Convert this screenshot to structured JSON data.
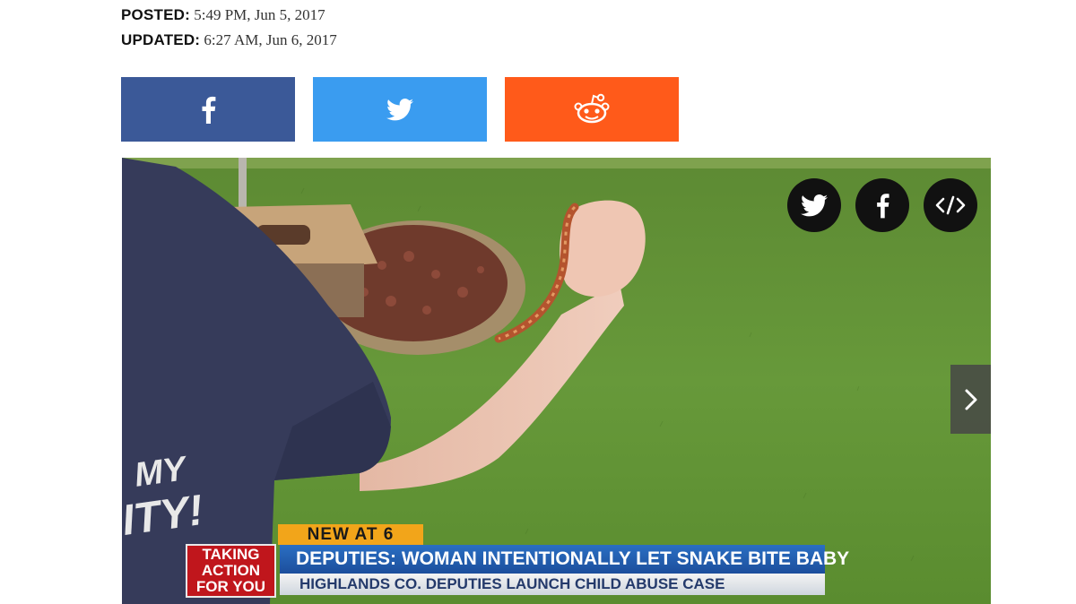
{
  "article": {
    "posted_label": "POSTED:",
    "posted_value": " 5:49 PM, Jun 5, 2017",
    "updated_label": "UPDATED:",
    "updated_value": " 6:27 AM, Jun 6, 2017"
  },
  "share": {
    "facebook_color": "#3b5998",
    "twitter_color": "#3a9cf0",
    "reddit_color": "#ff5a1a",
    "icons": [
      "facebook-icon",
      "twitter-icon",
      "reddit-icon"
    ]
  },
  "video": {
    "overlay_icons": [
      "twitter-icon",
      "facebook-icon",
      "embed-code-icon"
    ],
    "next_icon": "chevron-right-icon",
    "lower_third": {
      "tag": "NEW AT 6",
      "taking_line1": "TAKING",
      "taking_line2": "ACTION",
      "taking_line3": "FOR YOU",
      "headline": "DEPUTIES: WOMAN INTENTIONALLY LET SNAKE BITE BABY",
      "subheadline": "HIGHLANDS CO. DEPUTIES LAUNCH CHILD ABUSE CASE"
    },
    "shirt_line1": "MY",
    "shirt_line2": "ITY!"
  }
}
